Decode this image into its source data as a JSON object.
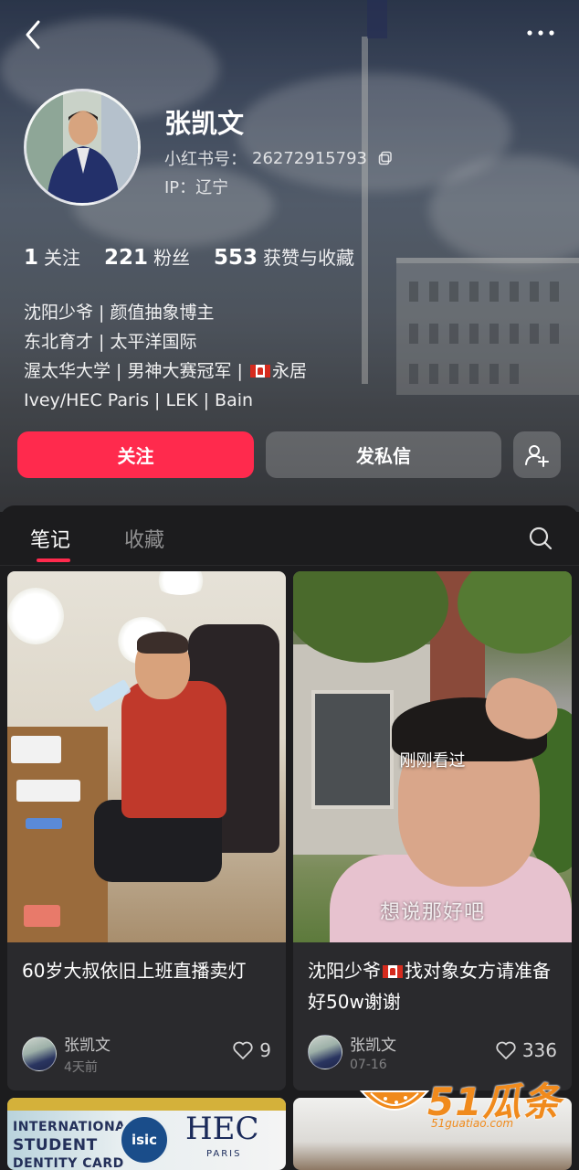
{
  "profile": {
    "name": "张凯文",
    "id_label": "小红书号：",
    "id_value": "26272915793",
    "ip_label": "IP：辽宁",
    "stats": [
      {
        "num": "1",
        "label": "关注"
      },
      {
        "num": "221",
        "label": "粉丝"
      },
      {
        "num": "553",
        "label": "获赞与收藏"
      }
    ],
    "bio": {
      "line1": "沈阳少爷 | 颜值抽象博主",
      "line2": "东北育才 | 太平洋国际",
      "line3_a": "渥太华大学 | 男神大赛冠军 | ",
      "line3_b": "永居",
      "line4": "Ivey/HEC Paris  |  LEK  |  Bain"
    }
  },
  "actions": {
    "follow_label": "关注",
    "message_label": "发私信"
  },
  "tabs": [
    {
      "label": "笔记",
      "active": true
    },
    {
      "label": "收藏",
      "active": false
    }
  ],
  "posts": [
    {
      "title": "60岁大叔依旧上班直播卖灯",
      "author": "张凯文",
      "date": "4天前",
      "likes": "9"
    },
    {
      "title_a": "沈阳少爷",
      "title_b": "找对象女方请准备好50w谢谢",
      "author": "张凯文",
      "date": "07-16",
      "likes": "336",
      "overlay": "刚刚看过",
      "subtitle": "想说那好吧"
    }
  ],
  "post3_thumb": {
    "card_text_1": "INTERNATIONAL",
    "card_text_2": "STUDENT",
    "card_text_3": "DENTITY CARD",
    "logo": "isic",
    "brand": "HEC",
    "brand_sub": "PARIS"
  },
  "watermark": {
    "text": "51瓜条",
    "sub": "51guatiao.com"
  },
  "colors": {
    "accent": "#ff2a4d",
    "background": "#1c1c1e",
    "card": "#2a2a2d"
  }
}
